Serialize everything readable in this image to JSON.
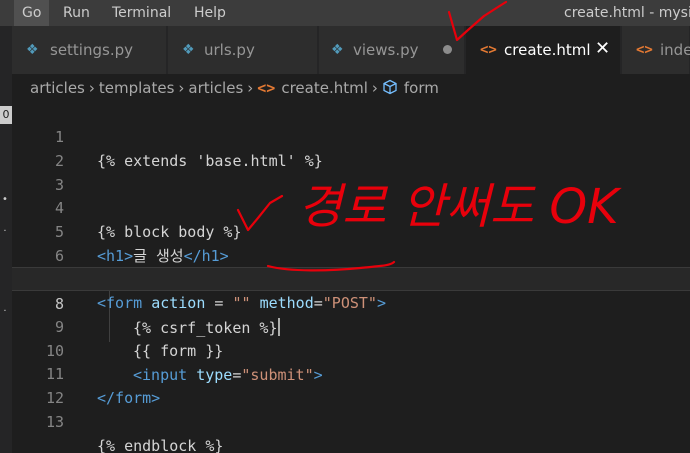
{
  "menu": {
    "items": [
      "Go",
      "Run",
      "Terminal",
      "Help"
    ],
    "active": "Go"
  },
  "window_title": "create.html - mysite",
  "activity": {
    "badge": "0"
  },
  "tabs": [
    {
      "label": "settings.py",
      "icon": "python-icon",
      "modified": false,
      "active": false
    },
    {
      "label": "urls.py",
      "icon": "python-icon",
      "modified": false,
      "active": false
    },
    {
      "label": "views.py",
      "icon": "python-icon",
      "modified": true,
      "active": false
    },
    {
      "label": "create.html",
      "icon": "html-icon",
      "modified": false,
      "active": true
    },
    {
      "label": "index",
      "icon": "html-icon",
      "modified": false,
      "active": false
    }
  ],
  "breadcrumb": [
    "articles",
    "templates",
    "articles",
    "create.html",
    "form"
  ],
  "code": {
    "line_numbers": [
      "1",
      "2",
      "3",
      "4",
      "5",
      "6",
      "7",
      "8",
      "9",
      "10",
      "11",
      "12",
      "13"
    ],
    "l1": "{% extends 'base.html' %}",
    "l4": "{% block body %}",
    "l5_open": "<h1>",
    "l5_text": "글 생성",
    "l5_close": "</h1>",
    "l7_open": "<form",
    "l7_action": "action",
    "l7_eq1": " = ",
    "l7_q": "\"\"",
    "l7_method": "method",
    "l7_eq2": "=",
    "l7_post": "\"POST\"",
    "l7_gt": ">",
    "l8": "{% csrf_token %}",
    "l9": "{{ form }}",
    "l10_open": "<input",
    "l10_type": "type",
    "l10_eq": "=",
    "l10_val": "\"submit\"",
    "l10_gt": ">",
    "l11": "</form>",
    "l13": "{% endblock %}"
  },
  "annotation": {
    "text": "경로 안써도 OK",
    "color": "#e8000b"
  }
}
